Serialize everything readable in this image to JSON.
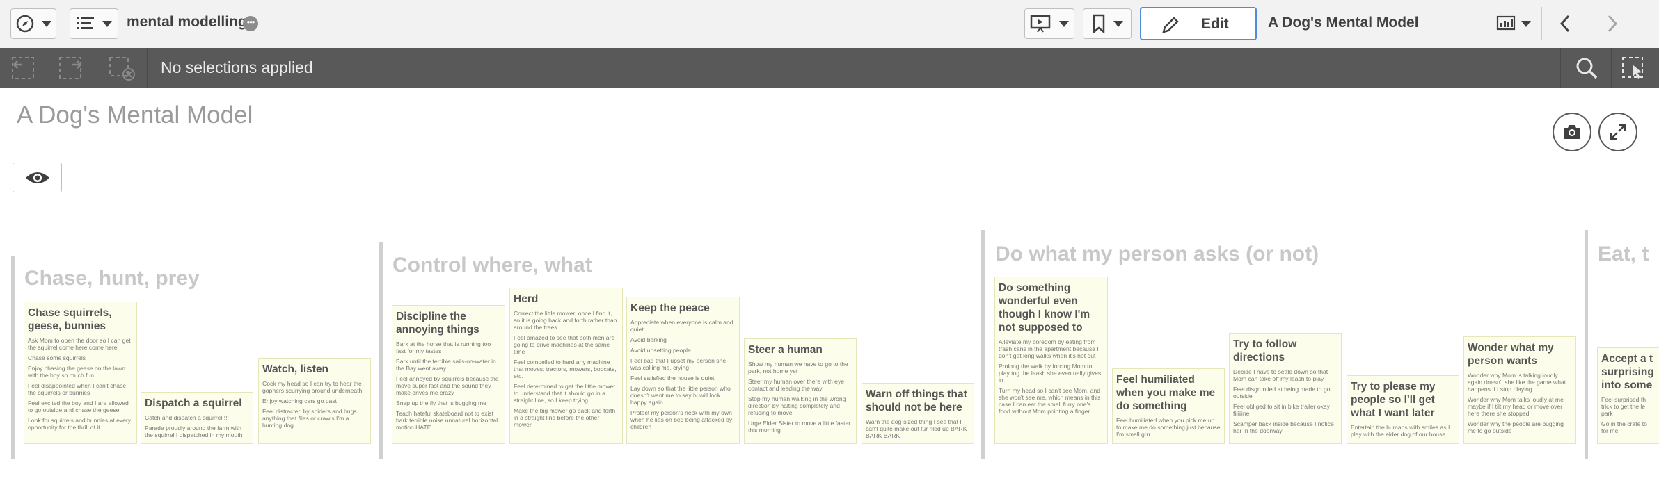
{
  "toolbar": {
    "app_name": "mental modelling",
    "more_symbol": "•••",
    "edit_label": "Edit",
    "sheet_title": "A Dog's Mental Model",
    "icons": [
      "compass-icon",
      "list-icon",
      "presentation-icon",
      "bookmark-icon",
      "pencil-icon",
      "sheet-grid-icon",
      "chevron-left-icon",
      "chevron-right-icon"
    ]
  },
  "selections": {
    "text": "No selections applied",
    "icons": [
      "step-back-icon",
      "step-forward-icon",
      "clear-selections-icon",
      "search-icon",
      "selection-tool-icon"
    ]
  },
  "sheet": {
    "title": "A Dog's Mental Model",
    "icons": [
      "camera-icon",
      "expand-icon",
      "eye-icon"
    ]
  },
  "colors": {
    "toolbar_bg": "#f2f2f2",
    "selection_bar_bg": "#595959",
    "card_bg": "#fdfdec",
    "group_title": "#c8c8c8",
    "edit_border": "#4a90d9"
  },
  "groups": [
    {
      "title": "Chase, hunt, prey"
    },
    {
      "title": "Control where, what"
    },
    {
      "title": "Do what my person asks (or not)"
    },
    {
      "title": "Eat, t"
    }
  ],
  "cards": [
    {
      "title": "Chase squirrels, geese, bunnies",
      "notes": [
        "Ask Mom to open the door so I can get the squirrel come here come here",
        "Chase some squirrels",
        "Enjoy chasing the geese on the lawn with the boy so much fun",
        "Feel disappointed when I can't chase the squirrels or bunnies",
        "Feel excited the boy and I are allowed to go outside and chase the geese",
        "Look for squirrels and bunnies at every opportunity for the thrill of it"
      ]
    },
    {
      "title": "Dispatch a squirrel",
      "notes": [
        "Catch and dispatch a squirrel!!!!",
        "Parade proudly around the farm with the squirrel I dispatched in my mouth"
      ]
    },
    {
      "title": "Watch, listen",
      "notes": [
        "Cock my head so I can try to hear the gophers scurrying around underneath",
        "Enjoy watching cars go past",
        "Feel distracted by spiders and bugs anything that flies or crawls I'm a hunting dog"
      ]
    },
    {
      "title": "Discipline the annoying things",
      "notes": [
        "Bark at the horse that is running too fast for my tastes",
        "Bark until the terrible sails-on-water in the Bay went away",
        "Feel annoyed by squirrels because the move super fast and the sound they make drives me crazy",
        "Snap up the fly that is bugging me",
        "Teach hateful skateboard not to exist bark terrible noise unnatural horizontal motion HATE"
      ]
    },
    {
      "title": "Herd",
      "notes": [
        "Correct the little mower, once I find it, so it is going back and forth rather than around the trees",
        "Feel amazed to see that both men are going to drive machines at the same time",
        "Feel compelled to herd any machine that moves: tractors, mowers, bobcats, etc.",
        "Feel determined to get the little mower to understand that it should go in a straight line, so I keep trying",
        "Make the big mower go back and forth in a straight line before the other mower"
      ]
    },
    {
      "title": "Keep the peace",
      "notes": [
        "Appreciate when everyone is calm and quiet",
        "Avoid barking",
        "Avoid upsetting people",
        "Feel bad that I upset my person she was calling me, crying",
        "Feel satisfied the house is quiet",
        "Lay down so that the little person who doesn't want me to say hi will look happy again",
        "Protect my person's neck with my own when he lies on bed being attacked by children"
      ]
    },
    {
      "title": "Steer a human",
      "notes": [
        "Show my human we have to go to the park, not home yet",
        "Steer my human over there with eye contact and leading the way",
        "Stop my human walking in the wrong direction by halting completely and refusing to move",
        "Urge Elder Sister to move a little faster this morning"
      ]
    },
    {
      "title": "Warn off things that should not be here",
      "notes": [
        "Warn the dog-sized thing I see that I can't quite make out fur riled up BARK BARK BARK"
      ]
    },
    {
      "title": "Do something wonderful even though I know I'm not supposed to",
      "notes": [
        "Alleviate my boredom by eating from trash cans in the apartment because I don't get long walks when it's hot out",
        "Prolong the walk by forcing Mom to play tug the leash she eventually gives in",
        "Turn my head so I can't see Mom, and she won't see me, which means in this case I can eat the small furry one's food without Mom pointing a finger"
      ]
    },
    {
      "title": "Feel humiliated when you make me do something",
      "notes": [
        "Feel humiliated when you pick me up to make me do something just because I'm small grrr"
      ]
    },
    {
      "title": "Try to follow directions",
      "notes": [
        "Decide I have to settle down so that Mom can take off my leash to play",
        "Feel disgruntled at being made to go outside",
        "Feel obliged to sit in bike trailer okay fiiiiiine",
        "Scamper back inside because I notice her in the doorway"
      ]
    },
    {
      "title": "Try to please my people so I'll get what I want later",
      "notes": [
        "Entertain the humans with smiles as I play with the elder dog of our house"
      ]
    },
    {
      "title": "Wonder what my person wants",
      "notes": [
        "Wonder why Mom is talking loudly again doesn't she like the game what happens if I stop playing",
        "Wonder why Mom talks loudly at me maybe if I tilt my head or move over here there she stopped",
        "Wonder why the people are bugging me to go outside"
      ]
    },
    {
      "title": "Accept a t surprising into some",
      "notes": [
        "Feel surprised th trick to get the le park",
        "Go in the crate to for me"
      ]
    }
  ]
}
